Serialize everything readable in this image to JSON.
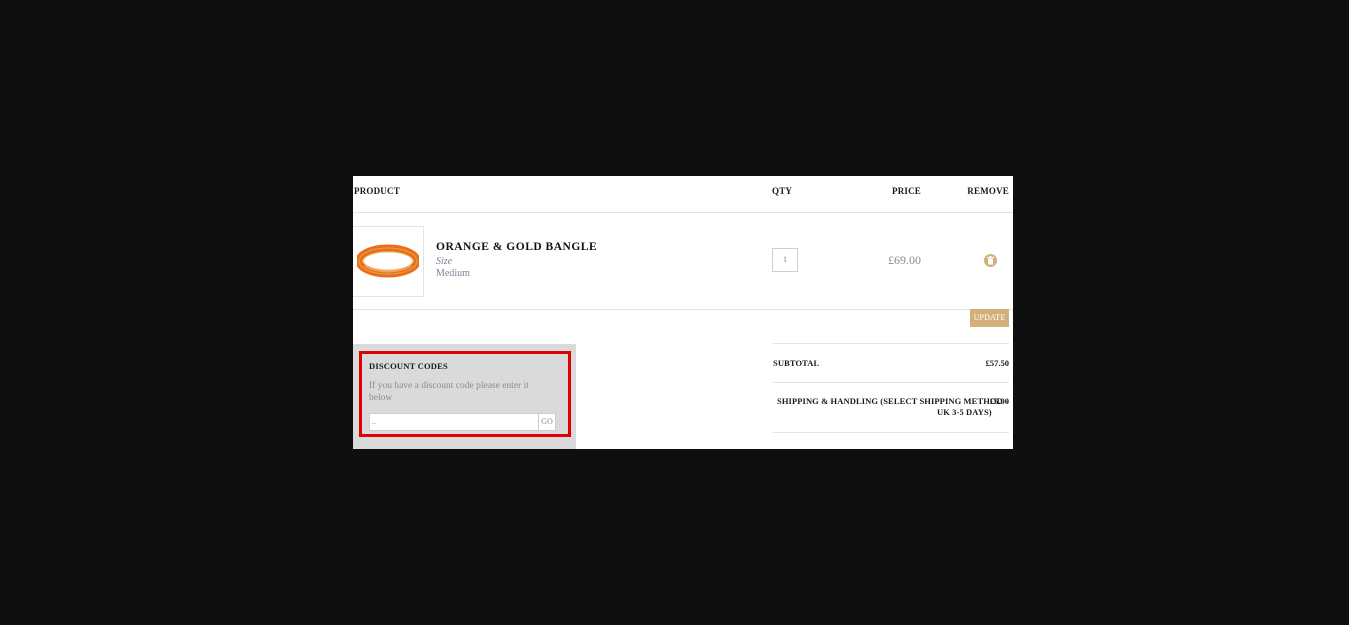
{
  "cart": {
    "headers": {
      "product": "PRODUCT",
      "qty": "QTY",
      "price": "PRICE",
      "remove": "REMOVE"
    },
    "items": [
      {
        "name": "ORANGE & GOLD BANGLE",
        "attribute_label": "Size",
        "attribute_value": "Medium",
        "qty": "1",
        "price": "£69.00",
        "image_icon": "orange-bangle-image",
        "remove_icon": "trash-icon"
      }
    ],
    "update_label": "UPDATE"
  },
  "discount": {
    "title": "DISCOUNT CODES",
    "description": "If you have a discount code please enter it below",
    "input_value": "..",
    "go_label": "GO"
  },
  "summary": {
    "subtotal_label": "SUBTOTAL",
    "subtotal_value": "£57.50",
    "shipping_label_line1": "SHIPPING & HANDLING (SELECT SHIPPING METHOD -",
    "shipping_label_line2": "UK 3-5 DAYS)",
    "shipping_value": "£5.00"
  },
  "colors": {
    "background": "#0f0f0f",
    "accent": "#d3b07a",
    "highlight": "#e00000",
    "discount_panel": "#d9dadc"
  }
}
